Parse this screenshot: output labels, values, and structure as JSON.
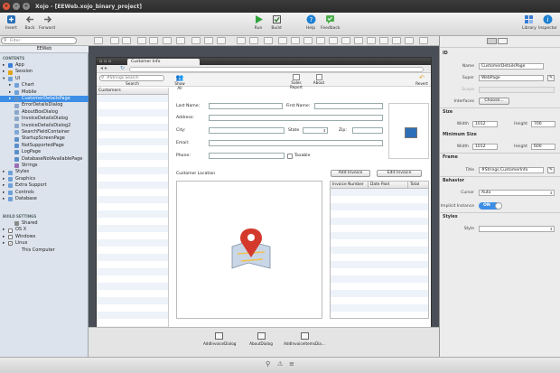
{
  "titlebar": {
    "title": "Xojo - [EEWeb.xojo_binary_project]",
    "close": "×",
    "min": "–",
    "max": "+"
  },
  "toolbar": {
    "insert": "Insert",
    "back": "Back",
    "forward": "Forward",
    "run": "Run",
    "build": "Build",
    "help": "Help",
    "feedback": "Feedback",
    "library": "Library",
    "inspector": "Inspector"
  },
  "navigator": {
    "filter_placeholder": "Filter",
    "project": "EEWeb",
    "contents_header": "CONTENTS",
    "items": [
      {
        "label": "App",
        "depth": 0,
        "arrow": "▸",
        "icon": "app"
      },
      {
        "label": "Session",
        "depth": 0,
        "arrow": "▸",
        "icon": "session"
      },
      {
        "label": "UI",
        "depth": 0,
        "arrow": "▾",
        "icon": "folder"
      },
      {
        "label": "Chart",
        "depth": 1,
        "arrow": "▸",
        "icon": "folder"
      },
      {
        "label": "Mobile",
        "depth": 1,
        "arrow": "▸",
        "icon": "folder"
      },
      {
        "label": "CustomerDetailsPage",
        "depth": 1,
        "arrow": "▸",
        "icon": "page",
        "selected": true
      },
      {
        "label": "ErrorDetailsDialog",
        "depth": 1,
        "arrow": "",
        "icon": "dialog"
      },
      {
        "label": "AboutBoxDialog",
        "depth": 1,
        "arrow": "",
        "icon": "dialog"
      },
      {
        "label": "InvoiceDetailsDialog",
        "depth": 1,
        "arrow": "",
        "icon": "dialog"
      },
      {
        "label": "InvoiceDetailsDialog2",
        "depth": 1,
        "arrow": "",
        "icon": "dialog"
      },
      {
        "label": "SearchFieldContainer",
        "depth": 1,
        "arrow": "",
        "icon": "container"
      },
      {
        "label": "StartupScreenPage",
        "depth": 1,
        "arrow": "",
        "icon": "page"
      },
      {
        "label": "NotSupportedPage",
        "depth": 1,
        "arrow": "",
        "icon": "page"
      },
      {
        "label": "LogPage",
        "depth": 1,
        "arrow": "",
        "icon": "page"
      },
      {
        "label": "DatabaseNotAvailablePage",
        "depth": 1,
        "arrow": "",
        "icon": "page"
      },
      {
        "label": "Strings",
        "depth": 1,
        "arrow": "",
        "icon": "strings"
      },
      {
        "label": "Styles",
        "depth": 0,
        "arrow": "▸",
        "icon": "folder"
      },
      {
        "label": "Graphics",
        "depth": 0,
        "arrow": "▸",
        "icon": "folder"
      },
      {
        "label": "Extra Support",
        "depth": 0,
        "arrow": "▸",
        "icon": "folder"
      },
      {
        "label": "Controls",
        "depth": 0,
        "arrow": "▸",
        "icon": "folder"
      },
      {
        "label": "Database",
        "depth": 0,
        "arrow": "▸",
        "icon": "folder"
      }
    ],
    "build_header": "BUILD SETTINGS",
    "build_items": [
      {
        "label": "Shared",
        "depth": 1,
        "arrow": "",
        "icon": "gear"
      },
      {
        "label": "OS X",
        "depth": 0,
        "arrow": "▸",
        "icon": "check"
      },
      {
        "label": "Windows",
        "depth": 0,
        "arrow": "▸",
        "icon": "check"
      },
      {
        "label": "Linux",
        "depth": 0,
        "arrow": "▸",
        "icon": "checkon"
      },
      {
        "label": "This Computer",
        "depth": 1,
        "arrow": "",
        "icon": "none"
      }
    ]
  },
  "page": {
    "window_title": "Customer Info",
    "search_placeholder": "#Strings.Search",
    "search_label": "Search",
    "show_all": "Show All",
    "sales_report": "Sales Report",
    "about": "About",
    "revert": "Revert",
    "customers_header": "Customers",
    "fields": {
      "last_name": "Last Name:",
      "first_name": "First Name:",
      "address": "Address:",
      "city": "City:",
      "state": "State",
      "zip": "Zip:",
      "email": "Email:",
      "phone": "Phone:",
      "taxable": "Taxable"
    },
    "customer_location": "Customer Location",
    "add_invoice": "Add Invoice",
    "edit_invoice": "Edit Invoice",
    "invoice_columns": [
      "Invoice Number",
      "Date Paid",
      "Total"
    ]
  },
  "tray": {
    "items": [
      "AddInvoiceDialog",
      "AboutDialog",
      "AddInvoiceItemsDia..."
    ]
  },
  "inspector": {
    "id_header": "ID",
    "name_label": "Name",
    "name_value": "CustomerDetailsPage",
    "super_label": "Super",
    "super_value": "WebPage",
    "scope_label": "Scope",
    "interfaces_label": "Interfaces",
    "interfaces_button": "Choose...",
    "size_header": "Size",
    "width_label": "Width",
    "width_value": "1012",
    "height_label": "Height",
    "height_value": "700",
    "min_size_header": "Minimum Size",
    "min_width_value": "1012",
    "min_height_value": "600",
    "frame_header": "Frame",
    "title_label": "Title",
    "title_value": "#Strings.CustomerInfo",
    "behavior_header": "Behavior",
    "cursor_label": "Cursor",
    "cursor_value": "Auto",
    "implicit_label": "Implicit Instance",
    "implicit_value": "ON",
    "styles_header": "Styles",
    "style_label": "Style"
  },
  "colors": {
    "selection": "#3d8ee6",
    "accent_blue": "#1c7fd1",
    "run_green": "#2fa33a",
    "row_stripe": "#eef3fa"
  }
}
